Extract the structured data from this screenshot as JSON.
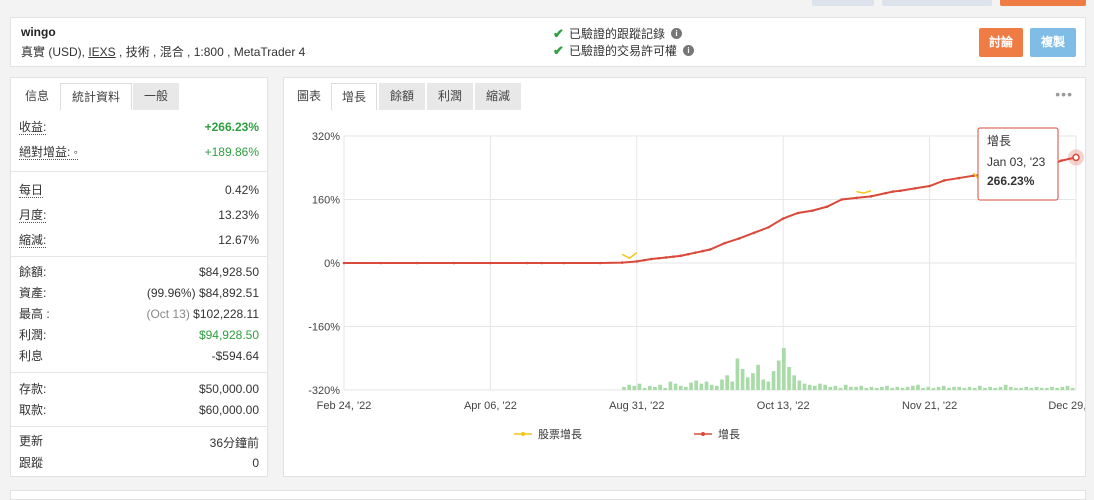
{
  "header": {
    "title": "wingo",
    "subtitle_pre": "真實 (USD), ",
    "subtitle_broker": "IEXS",
    "subtitle_post": " , 技術 , 混合 , 1:800 , MetaTrader 4",
    "verified_track": "已驗證的跟蹤記錄",
    "verified_trading": "已驗證的交易許可權",
    "discuss_label": "討論",
    "copy_label": "複製"
  },
  "left_tabs": [
    "信息",
    "統計資料",
    "一般"
  ],
  "stats": {
    "gain_label": "收益:",
    "gain_value": "+266.23%",
    "abs_gain_label": "絕對增益: ◦",
    "abs_gain_value": "+189.86%",
    "daily_label": "每日",
    "daily_value": "0.42%",
    "monthly_label": "月度:",
    "monthly_value": "13.23%",
    "drawdown_label": "縮減:",
    "drawdown_value": "12.67%",
    "balance_label": "餘額:",
    "balance_value": "$84,928.50",
    "equity_label": "資產:",
    "equity_pct": "(99.96%)",
    "equity_value": "$84,892.51",
    "highest_label": "最高 :",
    "highest_date": "(Oct 13)",
    "highest_value": "$102,228.11",
    "profit_label": "利潤:",
    "profit_value": "$94,928.50",
    "interest_label": "利息",
    "interest_value": "-$594.64",
    "deposits_label": "存款:",
    "deposits_value": "$50,000.00",
    "withdrawals_label": "取款:",
    "withdrawals_value": "$60,000.00",
    "updated_label": "更新",
    "updated_value": "36分鐘前",
    "tracking_label": "跟蹤",
    "tracking_value": "0"
  },
  "right_tabs": [
    "圖表",
    "增長",
    "餘額",
    "利潤",
    "縮減"
  ],
  "more_icon": "ellipsis-icon",
  "tooltip": {
    "series": "增長",
    "date": "Jan 03, '23",
    "value": "266.23%"
  },
  "legend": {
    "equity_label": "股票增長",
    "growth_label": "增長"
  },
  "colors": {
    "growth": "#d94a3a",
    "equity": "#f5c518",
    "volume": "#a8dba8",
    "discuss": "#f07c45",
    "copy": "#7fbce6"
  },
  "chart_data": {
    "type": "line",
    "title": "",
    "x_tick_labels": [
      "Feb 24, '22",
      "Apr 06, '22",
      "Aug 31, '22",
      "Oct 13, '22",
      "Nov 21, '22",
      "Dec 29, '22"
    ],
    "y_tick_labels": [
      "320%",
      "160%",
      "0%",
      "-160%",
      "-320%"
    ],
    "ylim": [
      -320,
      320
    ],
    "grid": true,
    "legend_position": "bottom",
    "series": [
      {
        "name": "增長",
        "x_index": [
          0,
          5,
          10,
          15,
          20,
          25,
          27,
          30,
          35,
          38,
          40,
          41,
          42,
          43,
          44,
          45,
          46,
          47,
          48,
          49,
          50,
          52,
          54,
          56,
          58,
          60,
          62,
          64,
          66,
          68,
          70,
          72,
          74,
          75,
          76,
          78,
          80,
          82,
          84,
          86,
          88,
          90,
          92,
          94,
          96,
          98,
          100
        ],
        "values": [
          0,
          0,
          0,
          0,
          0,
          0,
          0,
          0,
          0,
          1,
          4,
          7,
          10,
          12,
          14,
          16,
          18,
          22,
          26,
          30,
          34,
          50,
          62,
          76,
          90,
          112,
          126,
          132,
          142,
          160,
          164,
          168,
          176,
          180,
          182,
          188,
          194,
          208,
          214,
          220,
          224,
          228,
          234,
          238,
          242,
          258,
          266
        ]
      },
      {
        "name": "股票增長",
        "x_index": [
          38,
          39,
          40,
          70,
          71,
          72,
          86,
          87,
          88
        ],
        "values": [
          22,
          12,
          26,
          180,
          176,
          182,
          226,
          206,
          234
        ]
      }
    ],
    "volume_bars": [
      3,
      5,
      4,
      6,
      2,
      4,
      3,
      5,
      2,
      8,
      6,
      4,
      3,
      7,
      9,
      6,
      8,
      5,
      4,
      10,
      14,
      8,
      30,
      20,
      12,
      16,
      24,
      10,
      8,
      18,
      28,
      40,
      22,
      14,
      9,
      6,
      5,
      4,
      6,
      5,
      3,
      4,
      2,
      5,
      3,
      3,
      4,
      2,
      3,
      2,
      3,
      4,
      2,
      3,
      2,
      3,
      4,
      5,
      2,
      3,
      2,
      3,
      4,
      2,
      3,
      3,
      2,
      3,
      2,
      4,
      2,
      3,
      2,
      3,
      5,
      3,
      2,
      2,
      3,
      2,
      3,
      2,
      2,
      3,
      2,
      3,
      4,
      2
    ],
    "volume_note": "relative heights, unlabeled"
  }
}
